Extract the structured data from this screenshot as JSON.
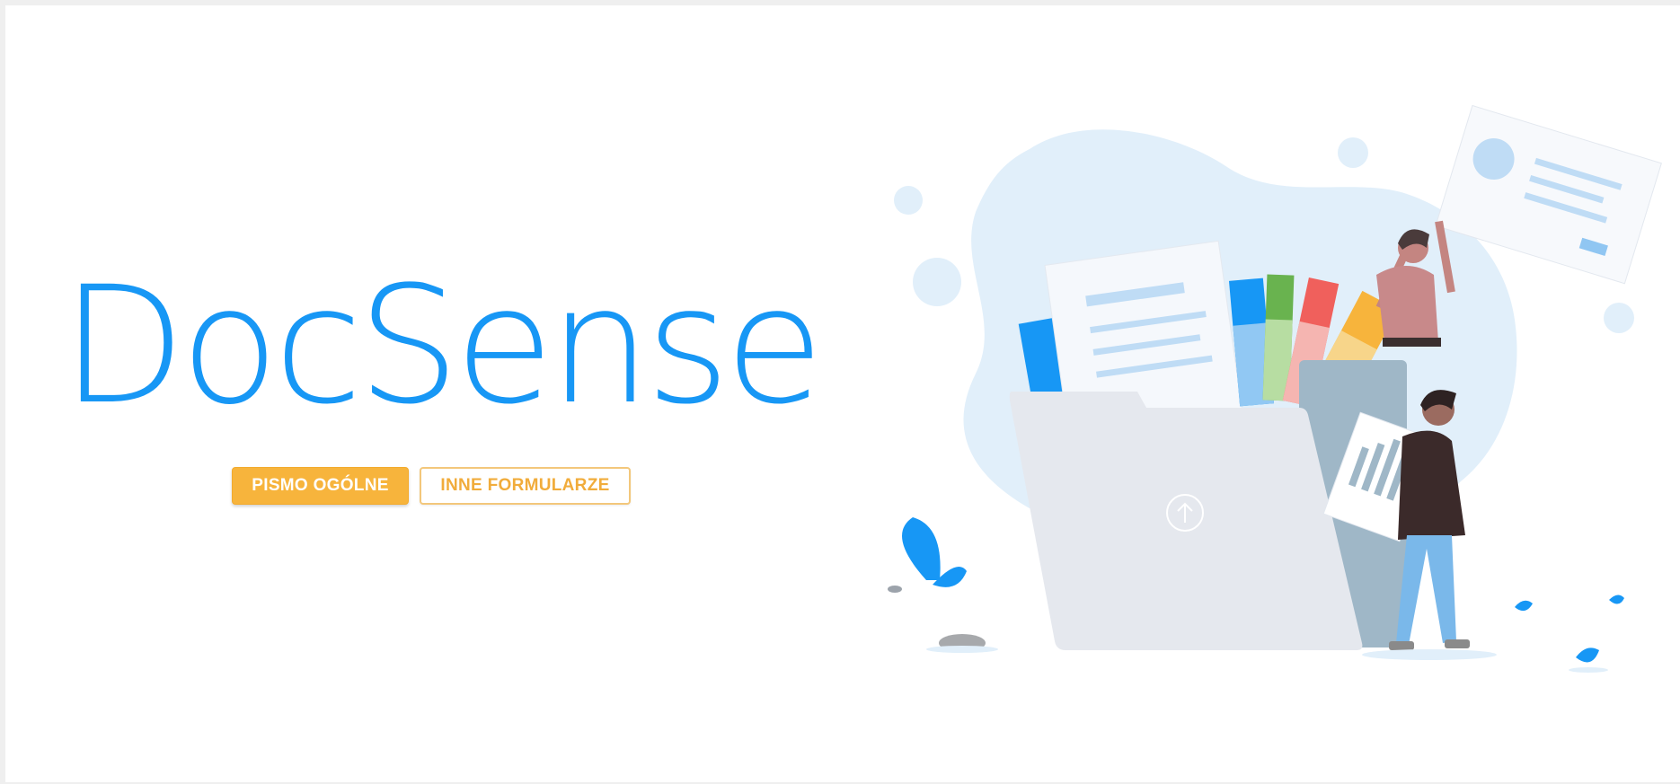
{
  "app": {
    "brand_name": "DocSense"
  },
  "actions": {
    "primary_label": "PISMO OGÓLNE",
    "secondary_label": "INNE FORMULARZE"
  },
  "illustration": {
    "description_icon": "folder-upload-illustration",
    "upload_icon": "arrow-up-circle-icon"
  },
  "colors": {
    "brand": "#1797f5",
    "accent": "#f7b43c",
    "background": "#ffffff"
  }
}
